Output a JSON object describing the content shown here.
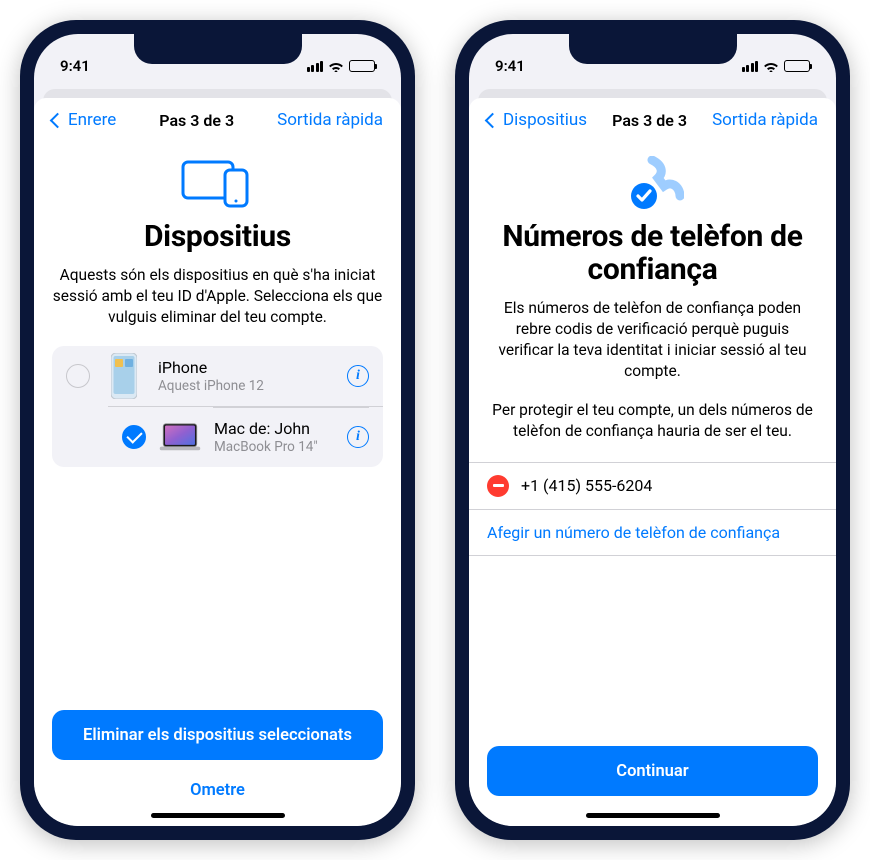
{
  "statusbar": {
    "time": "9:41"
  },
  "left": {
    "nav": {
      "back": "Enrere",
      "step": "Pas 3 de 3",
      "quick_exit": "Sortida ràpida"
    },
    "title": "Dispositius",
    "subtitle": "Aquests són els dispositius en què s'ha iniciat sessió amb el teu ID d'Apple. Selecciona els que vulguis eliminar del teu compte.",
    "devices": [
      {
        "name": "iPhone",
        "model": "Aquest iPhone 12",
        "checked": false
      },
      {
        "name": "Mac de: John",
        "model": "MacBook Pro 14\"",
        "checked": true
      }
    ],
    "actions": {
      "primary": "Eliminar els dispositius seleccionats",
      "skip": "Ometre"
    }
  },
  "right": {
    "nav": {
      "back": "Dispositius",
      "step": "Pas 3 de 3",
      "quick_exit": "Sortida ràpida"
    },
    "title": "Números de telèfon de confiança",
    "subtitle1": "Els números de telèfon de confiança poden rebre codis de verificació perquè puguis verificar la teva identitat i iniciar sessió al teu compte.",
    "subtitle2": "Per protegir el teu compte, un dels números de telèfon de confiança hauria de ser el teu.",
    "numbers": [
      {
        "value": "+1 (415) 555-6204"
      }
    ],
    "add_link": "Afegir un número de telèfon de confiança",
    "actions": {
      "primary": "Continuar"
    }
  }
}
